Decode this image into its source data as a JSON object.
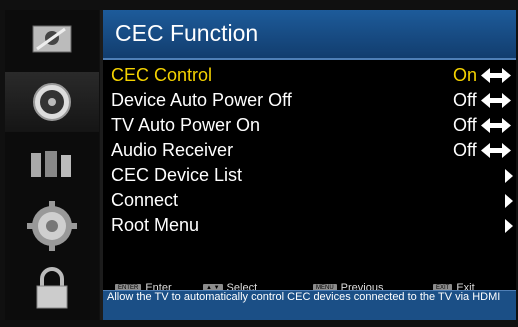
{
  "title": "CEC Function",
  "menu": [
    {
      "label": "CEC Control",
      "value": "On",
      "control": "toggle"
    },
    {
      "label": "Device Auto Power Off",
      "value": "Off",
      "control": "toggle"
    },
    {
      "label": "TV Auto Power On",
      "value": "Off",
      "control": "toggle"
    },
    {
      "label": "Audio Receiver",
      "value": "Off",
      "control": "toggle"
    },
    {
      "label": "CEC Device List",
      "value": "",
      "control": "submenu"
    },
    {
      "label": "Connect",
      "value": "",
      "control": "submenu"
    },
    {
      "label": "Root Menu",
      "value": "",
      "control": "submenu"
    }
  ],
  "help": {
    "enter_key": "ENTER",
    "enter": "Enter",
    "select": "Select",
    "menu_key": "MENU",
    "previous": "Previous",
    "exit_key": "EXIT",
    "exit": "Exit"
  },
  "description": "Allow the TV to automatically control CEC devices connected to the TV via HDMI",
  "sidebar": [
    "picture-icon",
    "audio-icon",
    "channel-icon",
    "settings-icon",
    "lock-icon"
  ],
  "colors": {
    "title_bar": "#1d5b9a",
    "active": "#f4d200",
    "description_bar": "#1b4f86"
  }
}
